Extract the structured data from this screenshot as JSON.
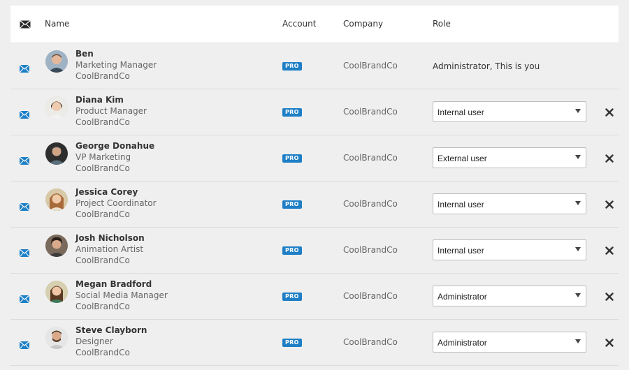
{
  "header": {
    "name": "Name",
    "account": "Account",
    "company": "Company",
    "role": "Role"
  },
  "colors": {
    "badge": "#1e7fc6",
    "mail_icon": "#1e7fc6",
    "remove_icon": "#333333",
    "background": "#efefef"
  },
  "rows": [
    {
      "name": "Ben",
      "title": "Marketing Manager",
      "company_line": "CoolBrandCo",
      "account": "PRO",
      "company": "CoolBrandCo",
      "role_text": "Administrator, This is you"
    },
    {
      "name": "Diana Kim",
      "title": "Product Manager",
      "company_line": "CoolBrandCo",
      "account": "PRO",
      "company": "CoolBrandCo",
      "role": "Internal user"
    },
    {
      "name": "George Donahue",
      "title": "VP Marketing",
      "company_line": "CoolBrandCo",
      "account": "PRO",
      "company": "CoolBrandCo",
      "role": "External user"
    },
    {
      "name": "Jessica Corey",
      "title": "Project Coordinator",
      "company_line": "CoolBrandCo",
      "account": "PRO",
      "company": "CoolBrandCo",
      "role": "Internal user"
    },
    {
      "name": "Josh Nicholson",
      "title": "Animation Artist",
      "company_line": "CoolBrandCo",
      "account": "PRO",
      "company": "CoolBrandCo",
      "role": "Internal user"
    },
    {
      "name": "Megan Bradford",
      "title": "Social Media Manager",
      "company_line": "CoolBrandCo",
      "account": "PRO",
      "company": "CoolBrandCo",
      "role": "Administrator"
    },
    {
      "name": "Steve Clayborn",
      "title": "Designer",
      "company_line": "CoolBrandCo",
      "account": "PRO",
      "company": "CoolBrandCo",
      "role": "Administrator"
    }
  ]
}
